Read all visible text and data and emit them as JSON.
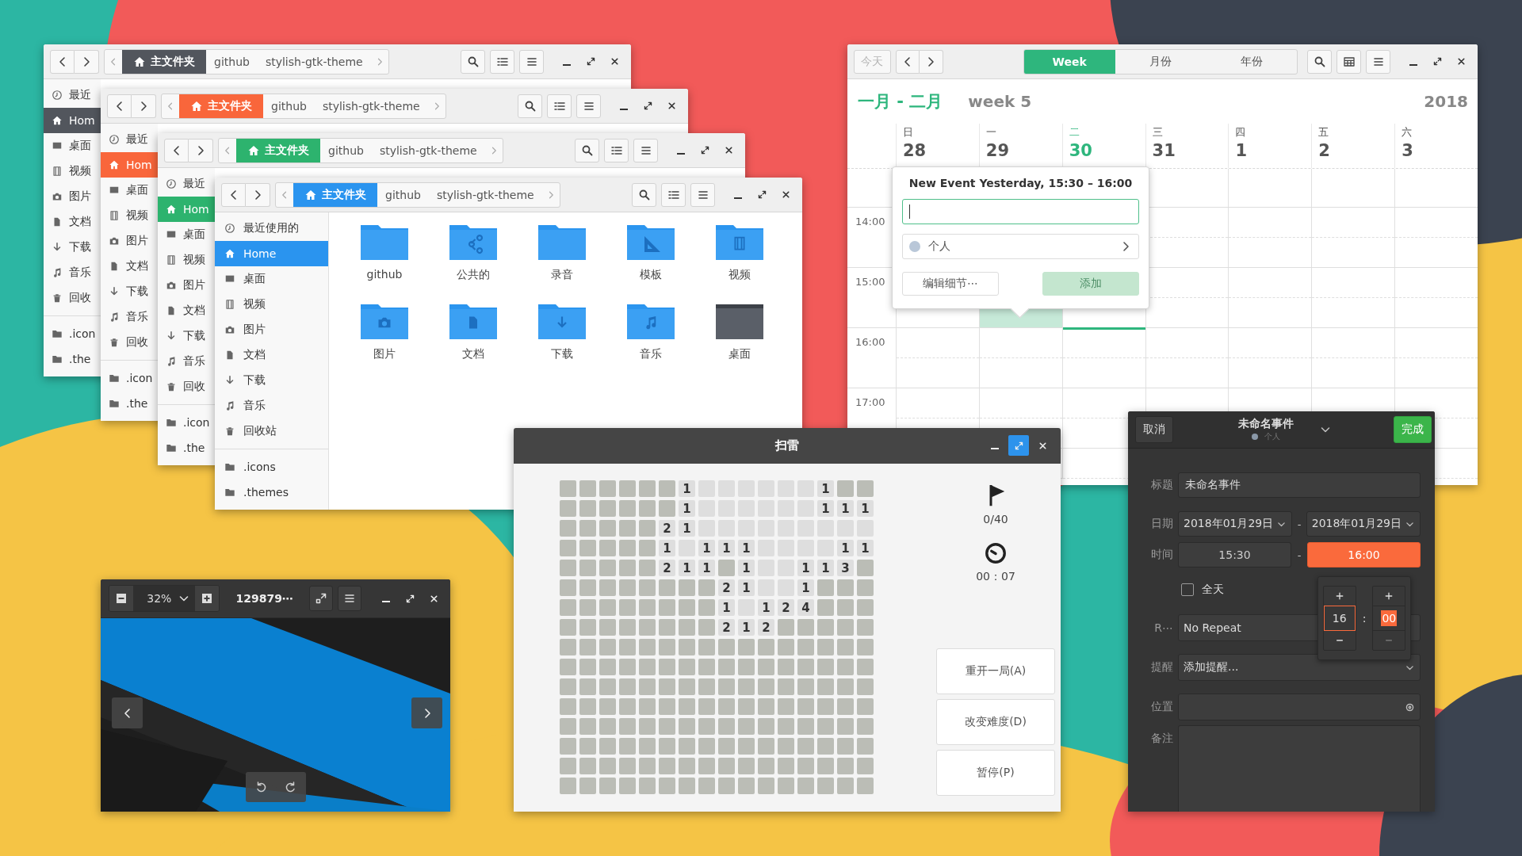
{
  "file_managers": [
    {
      "color": "#52565d",
      "breadcrumb": [
        "主文件夹",
        "github",
        "stylish-gtk-theme"
      ],
      "places": [
        {
          "label": "最近",
          "selected": false
        },
        {
          "label": "Hom",
          "selected": true
        },
        {
          "label": "桌面",
          "selected": false
        },
        {
          "label": "视频",
          "selected": false
        },
        {
          "label": "图片",
          "selected": false
        },
        {
          "label": "文档",
          "selected": false
        },
        {
          "label": "下载",
          "selected": false
        },
        {
          "label": "音乐",
          "selected": false
        },
        {
          "label": "回收",
          "selected": false
        }
      ],
      "bookmarks": [
        {
          "label": ".icon",
          "selected": false
        },
        {
          "label": ".the",
          "selected": false
        }
      ]
    },
    {
      "color": "#f9663b",
      "breadcrumb": [
        "主文件夹",
        "github",
        "stylish-gtk-theme"
      ],
      "places": [
        {
          "label": "最近",
          "selected": false
        },
        {
          "label": "Hom",
          "selected": true
        },
        {
          "label": "桌面",
          "selected": false
        },
        {
          "label": "视频",
          "selected": false
        },
        {
          "label": "图片",
          "selected": false
        },
        {
          "label": "文档",
          "selected": false
        },
        {
          "label": "下载",
          "selected": false
        },
        {
          "label": "音乐",
          "selected": false
        },
        {
          "label": "回收",
          "selected": false
        }
      ],
      "bookmarks": [
        {
          "label": ".icon",
          "selected": false
        },
        {
          "label": ".the",
          "selected": false
        }
      ]
    },
    {
      "color": "#2db36e",
      "breadcrumb": [
        "主文件夹",
        "github",
        "stylish-gtk-theme"
      ],
      "places": [
        {
          "label": "最近",
          "selected": false
        },
        {
          "label": "Hom",
          "selected": true
        },
        {
          "label": "桌面",
          "selected": false
        },
        {
          "label": "视频",
          "selected": false
        },
        {
          "label": "图片",
          "selected": false
        },
        {
          "label": "文档",
          "selected": false
        },
        {
          "label": "下载",
          "selected": false
        },
        {
          "label": "音乐",
          "selected": false
        },
        {
          "label": "回收",
          "selected": false
        }
      ],
      "bookmarks": [
        {
          "label": ".icon",
          "selected": false
        },
        {
          "label": ".the",
          "selected": false
        }
      ]
    },
    {
      "color": "#2a94ef",
      "breadcrumb": [
        "主文件夹",
        "github",
        "stylish-gtk-theme"
      ],
      "places": [
        {
          "label": "最近使用的",
          "selected": false
        },
        {
          "label": "Home",
          "selected": true
        },
        {
          "label": "桌面",
          "selected": false
        },
        {
          "label": "视频",
          "selected": false
        },
        {
          "label": "图片",
          "selected": false
        },
        {
          "label": "文档",
          "selected": false
        },
        {
          "label": "下载",
          "selected": false
        },
        {
          "label": "音乐",
          "selected": false
        },
        {
          "label": "回收站",
          "selected": false
        }
      ],
      "bookmarks": [
        {
          "label": ".icons",
          "selected": false
        },
        {
          "label": ".themes",
          "selected": false
        }
      ],
      "folders": [
        {
          "label": "github"
        },
        {
          "label": "公共的"
        },
        {
          "label": "录音"
        },
        {
          "label": "模板"
        },
        {
          "label": "视频"
        },
        {
          "label": "图片"
        },
        {
          "label": "文档"
        },
        {
          "label": "下载"
        },
        {
          "label": "音乐"
        },
        {
          "label": "桌面"
        }
      ]
    }
  ],
  "calendar": {
    "today_button": "今天",
    "today_disabled": true,
    "views": [
      {
        "label": "Week",
        "selected": true
      },
      {
        "label": "月份",
        "selected": false
      },
      {
        "label": "年份",
        "selected": false
      }
    ],
    "range": "一月 - 二月",
    "week": "week 5",
    "year": "2018",
    "days": [
      {
        "weekday": "日",
        "date": "28",
        "today": false,
        "selected": false
      },
      {
        "weekday": "一",
        "date": "29",
        "today": false,
        "selected": true
      },
      {
        "weekday": "二",
        "date": "30",
        "today": true,
        "selected": false
      },
      {
        "weekday": "三",
        "date": "31",
        "today": false,
        "selected": false
      },
      {
        "weekday": "四",
        "date": "1",
        "today": false,
        "selected": false
      },
      {
        "weekday": "五",
        "date": "2",
        "today": false,
        "selected": false
      },
      {
        "weekday": "六",
        "date": "3",
        "today": false,
        "selected": false
      }
    ],
    "hours": [
      "14:00",
      "15:00",
      "16:00",
      "17:00"
    ],
    "popover": {
      "title": "New Event Yesterday, 15:30 – 16:00",
      "calendar": "个人",
      "edit_button": "编辑细节⋯",
      "add_button": "添加",
      "add_disabled": true
    }
  },
  "minesweeper": {
    "title": "扫雷",
    "flags": "0/40",
    "time": "00：07",
    "buttons": [
      "重开一局(A)",
      "改变难度(D)",
      "暂停(P)"
    ],
    "rows": [
      {
        "cells": [
          {
            "revealed": false
          },
          {
            "revealed": false
          },
          {
            "revealed": false
          },
          {
            "revealed": false
          },
          {
            "revealed": false
          },
          {
            "revealed": false
          },
          {
            "revealed": true,
            "number": "1"
          },
          {
            "revealed": true
          },
          {
            "revealed": true
          },
          {
            "revealed": true
          },
          {
            "revealed": true
          },
          {
            "revealed": true
          },
          {
            "revealed": true
          },
          {
            "revealed": true,
            "number": "1"
          },
          {
            "revealed": false
          },
          {
            "revealed": false
          }
        ]
      },
      {
        "cells": [
          {
            "revealed": false
          },
          {
            "revealed": false
          },
          {
            "revealed": false
          },
          {
            "revealed": false
          },
          {
            "revealed": false
          },
          {
            "revealed": false
          },
          {
            "revealed": true,
            "number": "1"
          },
          {
            "revealed": true
          },
          {
            "revealed": true
          },
          {
            "revealed": true
          },
          {
            "revealed": true
          },
          {
            "revealed": true
          },
          {
            "revealed": true
          },
          {
            "revealed": true,
            "number": "1"
          },
          {
            "revealed": true,
            "number": "1"
          },
          {
            "revealed": true,
            "number": "1"
          }
        ]
      },
      {
        "cells": [
          {
            "revealed": false
          },
          {
            "revealed": false
          },
          {
            "revealed": false
          },
          {
            "revealed": false
          },
          {
            "revealed": false
          },
          {
            "revealed": true,
            "number": "2"
          },
          {
            "revealed": true,
            "number": "1"
          },
          {
            "revealed": true
          },
          {
            "revealed": true
          },
          {
            "revealed": true
          },
          {
            "revealed": true
          },
          {
            "revealed": true
          },
          {
            "revealed": true
          },
          {
            "revealed": true
          },
          {
            "revealed": true
          },
          {
            "revealed": true
          }
        ]
      },
      {
        "cells": [
          {
            "revealed": false
          },
          {
            "revealed": false
          },
          {
            "revealed": false
          },
          {
            "revealed": false
          },
          {
            "revealed": false
          },
          {
            "revealed": true,
            "number": "1"
          },
          {
            "revealed": true
          },
          {
            "revealed": true,
            "number": "1"
          },
          {
            "revealed": true,
            "number": "1"
          },
          {
            "revealed": true,
            "number": "1"
          },
          {
            "revealed": true
          },
          {
            "revealed": true
          },
          {
            "revealed": true
          },
          {
            "revealed": true
          },
          {
            "revealed": true,
            "number": "1"
          },
          {
            "revealed": true,
            "number": "1"
          }
        ]
      },
      {
        "cells": [
          {
            "revealed": false
          },
          {
            "revealed": false
          },
          {
            "revealed": false
          },
          {
            "revealed": false
          },
          {
            "revealed": false
          },
          {
            "revealed": true,
            "number": "2"
          },
          {
            "revealed": true,
            "number": "1"
          },
          {
            "revealed": true,
            "number": "1"
          },
          {
            "revealed": false
          },
          {
            "revealed": true,
            "number": "1"
          },
          {
            "revealed": true
          },
          {
            "revealed": true
          },
          {
            "revealed": true,
            "number": "1"
          },
          {
            "revealed": true,
            "number": "1"
          },
          {
            "revealed": true,
            "number": "3"
          },
          {
            "revealed": false
          }
        ]
      },
      {
        "cells": [
          {
            "revealed": false
          },
          {
            "revealed": false
          },
          {
            "revealed": false
          },
          {
            "revealed": false
          },
          {
            "revealed": false
          },
          {
            "revealed": false
          },
          {
            "revealed": false
          },
          {
            "revealed": false
          },
          {
            "revealed": true,
            "number": "2"
          },
          {
            "revealed": true,
            "number": "1"
          },
          {
            "revealed": true
          },
          {
            "revealed": true
          },
          {
            "revealed": true,
            "number": "1"
          },
          {
            "revealed": false
          },
          {
            "revealed": false
          },
          {
            "revealed": false
          }
        ]
      },
      {
        "cells": [
          {
            "revealed": false
          },
          {
            "revealed": false
          },
          {
            "revealed": false
          },
          {
            "revealed": false
          },
          {
            "revealed": false
          },
          {
            "revealed": false
          },
          {
            "revealed": false
          },
          {
            "revealed": false
          },
          {
            "revealed": true,
            "number": "1"
          },
          {
            "revealed": true
          },
          {
            "revealed": true,
            "number": "1"
          },
          {
            "revealed": true,
            "number": "2"
          },
          {
            "revealed": true,
            "number": "4"
          },
          {
            "revealed": false
          },
          {
            "revealed": false
          },
          {
            "revealed": false
          }
        ]
      },
      {
        "cells": [
          {
            "revealed": false
          },
          {
            "revealed": false
          },
          {
            "revealed": false
          },
          {
            "revealed": false
          },
          {
            "revealed": false
          },
          {
            "revealed": false
          },
          {
            "revealed": false
          },
          {
            "revealed": false
          },
          {
            "revealed": true,
            "number": "2"
          },
          {
            "revealed": true,
            "number": "1"
          },
          {
            "revealed": true,
            "number": "2"
          },
          {
            "revealed": false
          },
          {
            "revealed": false
          },
          {
            "revealed": false
          },
          {
            "revealed": false
          },
          {
            "revealed": false
          }
        ]
      },
      {
        "cells": [
          {
            "revealed": false
          },
          {
            "revealed": false
          },
          {
            "revealed": false
          },
          {
            "revealed": false
          },
          {
            "revealed": false
          },
          {
            "revealed": false
          },
          {
            "revealed": false
          },
          {
            "revealed": false
          },
          {
            "revealed": false
          },
          {
            "revealed": false
          },
          {
            "revealed": false
          },
          {
            "revealed": false
          },
          {
            "revealed": false
          },
          {
            "revealed": false
          },
          {
            "revealed": false
          },
          {
            "revealed": false
          }
        ]
      },
      {
        "cells": [
          {
            "revealed": false
          },
          {
            "revealed": false
          },
          {
            "revealed": false
          },
          {
            "revealed": false
          },
          {
            "revealed": false
          },
          {
            "revealed": false
          },
          {
            "revealed": false
          },
          {
            "revealed": false
          },
          {
            "revealed": false
          },
          {
            "revealed": false
          },
          {
            "revealed": false
          },
          {
            "revealed": false
          },
          {
            "revealed": false
          },
          {
            "revealed": false
          },
          {
            "revealed": false
          },
          {
            "revealed": false
          }
        ]
      },
      {
        "cells": [
          {
            "revealed": false
          },
          {
            "revealed": false
          },
          {
            "revealed": false
          },
          {
            "revealed": false
          },
          {
            "revealed": false
          },
          {
            "revealed": false
          },
          {
            "revealed": false
          },
          {
            "revealed": false
          },
          {
            "revealed": false
          },
          {
            "revealed": false
          },
          {
            "revealed": false
          },
          {
            "revealed": false
          },
          {
            "revealed": false
          },
          {
            "revealed": false
          },
          {
            "revealed": false
          },
          {
            "revealed": false
          }
        ]
      },
      {
        "cells": [
          {
            "revealed": false
          },
          {
            "revealed": false
          },
          {
            "revealed": false
          },
          {
            "revealed": false
          },
          {
            "revealed": false
          },
          {
            "revealed": false
          },
          {
            "revealed": false
          },
          {
            "revealed": false
          },
          {
            "revealed": false
          },
          {
            "revealed": false
          },
          {
            "revealed": false
          },
          {
            "revealed": false
          },
          {
            "revealed": false
          },
          {
            "revealed": false
          },
          {
            "revealed": false
          },
          {
            "revealed": false
          }
        ]
      },
      {
        "cells": [
          {
            "revealed": false
          },
          {
            "revealed": false
          },
          {
            "revealed": false
          },
          {
            "revealed": false
          },
          {
            "revealed": false
          },
          {
            "revealed": false
          },
          {
            "revealed": false
          },
          {
            "revealed": false
          },
          {
            "revealed": false
          },
          {
            "revealed": false
          },
          {
            "revealed": false
          },
          {
            "revealed": false
          },
          {
            "revealed": false
          },
          {
            "revealed": false
          },
          {
            "revealed": false
          },
          {
            "revealed": false
          }
        ]
      },
      {
        "cells": [
          {
            "revealed": false
          },
          {
            "revealed": false
          },
          {
            "revealed": false
          },
          {
            "revealed": false
          },
          {
            "revealed": false
          },
          {
            "revealed": false
          },
          {
            "revealed": false
          },
          {
            "revealed": false
          },
          {
            "revealed": false
          },
          {
            "revealed": false
          },
          {
            "revealed": false
          },
          {
            "revealed": false
          },
          {
            "revealed": false
          },
          {
            "revealed": false
          },
          {
            "revealed": false
          },
          {
            "revealed": false
          }
        ]
      },
      {
        "cells": [
          {
            "revealed": false
          },
          {
            "revealed": false
          },
          {
            "revealed": false
          },
          {
            "revealed": false
          },
          {
            "revealed": false
          },
          {
            "revealed": false
          },
          {
            "revealed": false
          },
          {
            "revealed": false
          },
          {
            "revealed": false
          },
          {
            "revealed": false
          },
          {
            "revealed": false
          },
          {
            "revealed": false
          },
          {
            "revealed": false
          },
          {
            "revealed": false
          },
          {
            "revealed": false
          },
          {
            "revealed": false
          }
        ]
      },
      {
        "cells": [
          {
            "revealed": false
          },
          {
            "revealed": false
          },
          {
            "revealed": false
          },
          {
            "revealed": false
          },
          {
            "revealed": false
          },
          {
            "revealed": false
          },
          {
            "revealed": false
          },
          {
            "revealed": false
          },
          {
            "revealed": false
          },
          {
            "revealed": false
          },
          {
            "revealed": false
          },
          {
            "revealed": false
          },
          {
            "revealed": false
          },
          {
            "revealed": false
          },
          {
            "revealed": false
          },
          {
            "revealed": false
          }
        ]
      }
    ]
  },
  "event_editor": {
    "cancel_button": "取消",
    "title": "未命名事件",
    "calendar": "个人",
    "done_button": "完成",
    "title_label": "标题",
    "title_value": "未命名事件",
    "date_label": "日期",
    "start_date": "2018年01月29日",
    "date_separator": "-",
    "end_date": "2018年01月29日",
    "time_label": "时间",
    "start_time": {
      "value": "15:30",
      "selected": false
    },
    "time_separator": "-",
    "end_time": {
      "value": "16:00",
      "selected": true
    },
    "all_day": {
      "label": "全天",
      "checked": false
    },
    "repeat_label": "R⋯",
    "repeat_value": "No Repeat",
    "reminder_label": "提醒",
    "reminder_value": "添加提醒...",
    "location_label": "位置",
    "notes_label": "备注",
    "time_picker": {
      "hour": "16",
      "separator": ":",
      "minute": "00"
    }
  },
  "image_viewer": {
    "zoom_level": "32%",
    "title": "129879⋯"
  }
}
